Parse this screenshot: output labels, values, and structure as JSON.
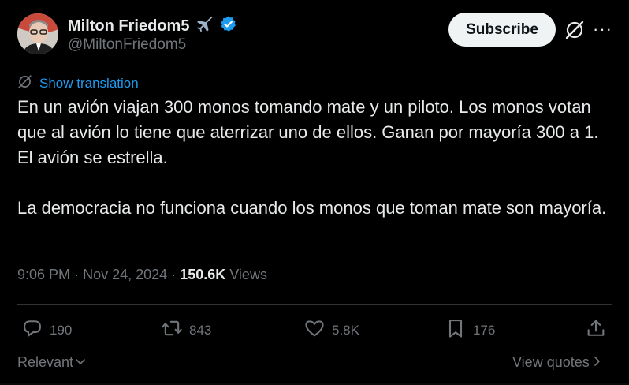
{
  "author": {
    "display_name": "Milton Friedom5",
    "handle": "@MiltonFriedom5",
    "verified_color": "#1d9bf0"
  },
  "header": {
    "subscribe_label": "Subscribe",
    "more_label": "···"
  },
  "tweet": {
    "show_translation": "Show translation",
    "paragraphs": [
      "En un avión viajan 300 monos tomando mate y un piloto. Los monos votan que al avión lo tiene que aterrizar uno de ellos. Ganan por mayoría 300 a 1. El avión se estrella.",
      "La democracia no funciona cuando los monos que toman mate son mayoría."
    ],
    "time": "9:06 PM",
    "date": "Nov 24, 2024",
    "separator": "·",
    "views_count": "150.6K",
    "views_label": "Views"
  },
  "actions": {
    "replies": "190",
    "reposts": "843",
    "likes": "5.8K",
    "bookmarks": "176"
  },
  "footer": {
    "relevant_label": "Relevant",
    "view_quotes_label": "View quotes"
  },
  "colors": {
    "background": "#000000",
    "text": "#e7e9ea",
    "muted": "#71767b",
    "accent": "#1d9bf0"
  }
}
